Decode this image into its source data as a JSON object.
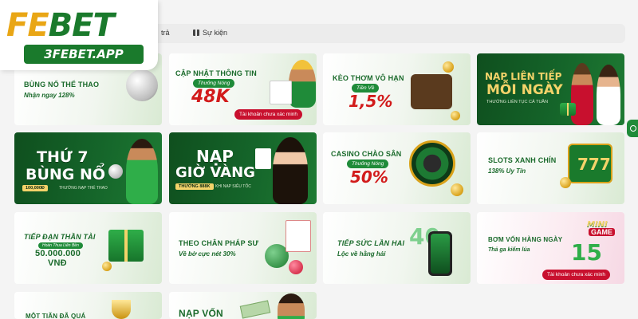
{
  "logo": {
    "brand_a": "FE",
    "brand_b": "BET",
    "domain": "3FEBET.APP"
  },
  "nav": {
    "prev": "trả",
    "event": "Sự kiện"
  },
  "icons": [
    "gift-icon",
    "support-tab-icon"
  ],
  "colors": {
    "brand_green": "#1a7a2c",
    "brand_gold": "#e9a615",
    "accent_red": "#c8102e"
  },
  "cards": {
    "c1": {
      "title": "BÙNG NỔ THỂ THAO",
      "subtitle": "Nhận ngay 128%"
    },
    "c2": {
      "title": "CẬP NHẬT THÔNG TIN",
      "tag": "Thưởng Nóng",
      "amount": "48K",
      "button": "Tài khoản chưa xác minh"
    },
    "c3": {
      "title": "KÈO THƠM VÔ HẠN",
      "tag": "Tiền Về",
      "amount": "1,5%"
    },
    "c4": {
      "title_a": "NẠP LIÊN TIẾP",
      "title_b": "MỖI NGÀY",
      "subtitle": "THƯỞNG LIÊN TỤC CẢ TUẦN"
    },
    "c5": {
      "title_a": "THỨ 7",
      "title_b": "BÙNG NỔ",
      "amount": "100,000Đ",
      "note": "THƯỞNG NẠP THỂ THAO"
    },
    "c6": {
      "title_a": "NẠP",
      "title_b": "GIỜ VÀNG",
      "amount": "THƯỞNG 888K",
      "note": "KHI NẠP SIÊU TỐC"
    },
    "c7": {
      "title": "CASINO CHÀO SÂN",
      "tag": "Thưởng Nóng",
      "amount": "50%"
    },
    "c8": {
      "title": "SLOTS XANH CHÍN",
      "subtitle": "138% Uy Tín"
    },
    "c9": {
      "title": "TIẾP ĐẠN THẦN TÀI",
      "tag": "Hoàn Thua Liên Bền",
      "amount": "50.000.000",
      "currency": "VNĐ"
    },
    "c10": {
      "title": "THEO CHÂN PHÁP SƯ",
      "subtitle": "Về bờ cực nét 30%"
    },
    "c11": {
      "title": "TIẾP SỨC LẦN HAI",
      "subtitle": "Lộc về hằng hải",
      "number": "40"
    },
    "c12": {
      "title": "BƠM VỐN HÀNG NGÀY",
      "subtitle": "Thả ga kiếm lúa",
      "game_a": "MINI",
      "game_b": "GAME",
      "number": "15",
      "button": "Tài khoản chưa xác minh"
    },
    "c13": {
      "title": "MỘT TIÃN ĐÃ QUÁ"
    },
    "c14": {
      "title": "NẠP VỐN"
    }
  }
}
